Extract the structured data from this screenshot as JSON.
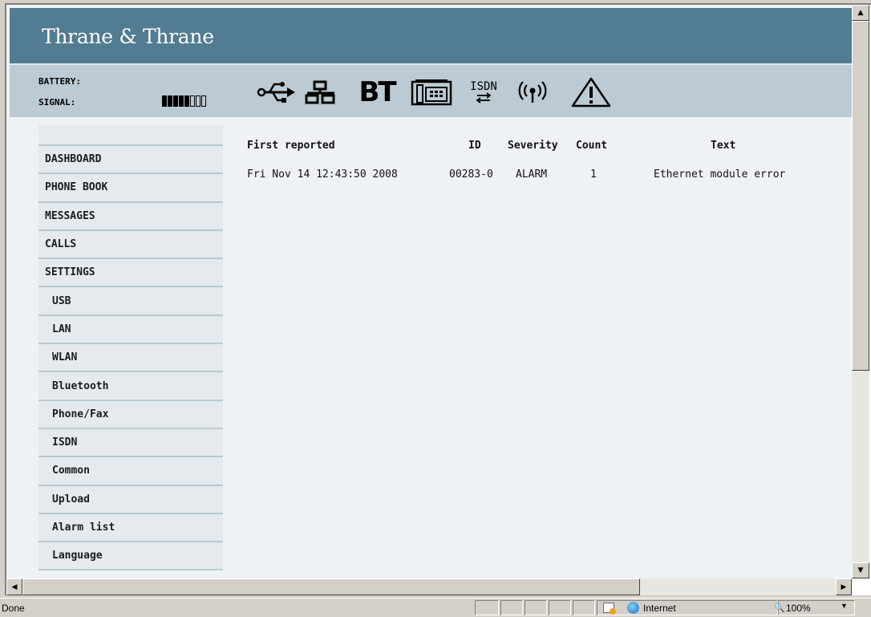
{
  "brand": {
    "logo_text": "Thrane & Thrane"
  },
  "device_status": {
    "battery_label": "BATTERY:",
    "signal_label": "SIGNAL:",
    "signal_level": 5,
    "signal_max": 8
  },
  "status_icons": [
    "usb-icon",
    "lan-icon",
    "bluetooth-icon",
    "phone-fax-icon",
    "isdn-icon",
    "wlan-icon",
    "warning-icon"
  ],
  "status_icon_texts": {
    "bluetooth": "BT",
    "isdn": "ISDN"
  },
  "nav": {
    "items": [
      {
        "label": "DASHBOARD",
        "sub": false
      },
      {
        "label": "PHONE BOOK",
        "sub": false
      },
      {
        "label": "MESSAGES",
        "sub": false
      },
      {
        "label": "CALLS",
        "sub": false
      },
      {
        "label": "SETTINGS",
        "sub": false
      },
      {
        "label": "USB",
        "sub": true
      },
      {
        "label": "LAN",
        "sub": true
      },
      {
        "label": "WLAN",
        "sub": true
      },
      {
        "label": "Bluetooth",
        "sub": true
      },
      {
        "label": "Phone/Fax",
        "sub": true
      },
      {
        "label": "ISDN",
        "sub": true
      },
      {
        "label": "Common",
        "sub": true
      },
      {
        "label": "Upload",
        "sub": true
      },
      {
        "label": "Alarm list",
        "sub": true
      },
      {
        "label": "Language",
        "sub": true
      }
    ]
  },
  "alarms": {
    "columns": [
      "First reported",
      "ID",
      "Severity",
      "Count",
      "Text"
    ],
    "rows": [
      [
        "Fri Nov 14 12:43:50 2008",
        "00283-0",
        "ALARM",
        "1",
        "Ethernet module error"
      ]
    ]
  },
  "browser": {
    "status_text": "Done",
    "zone": "Internet",
    "zoom": "100%"
  }
}
